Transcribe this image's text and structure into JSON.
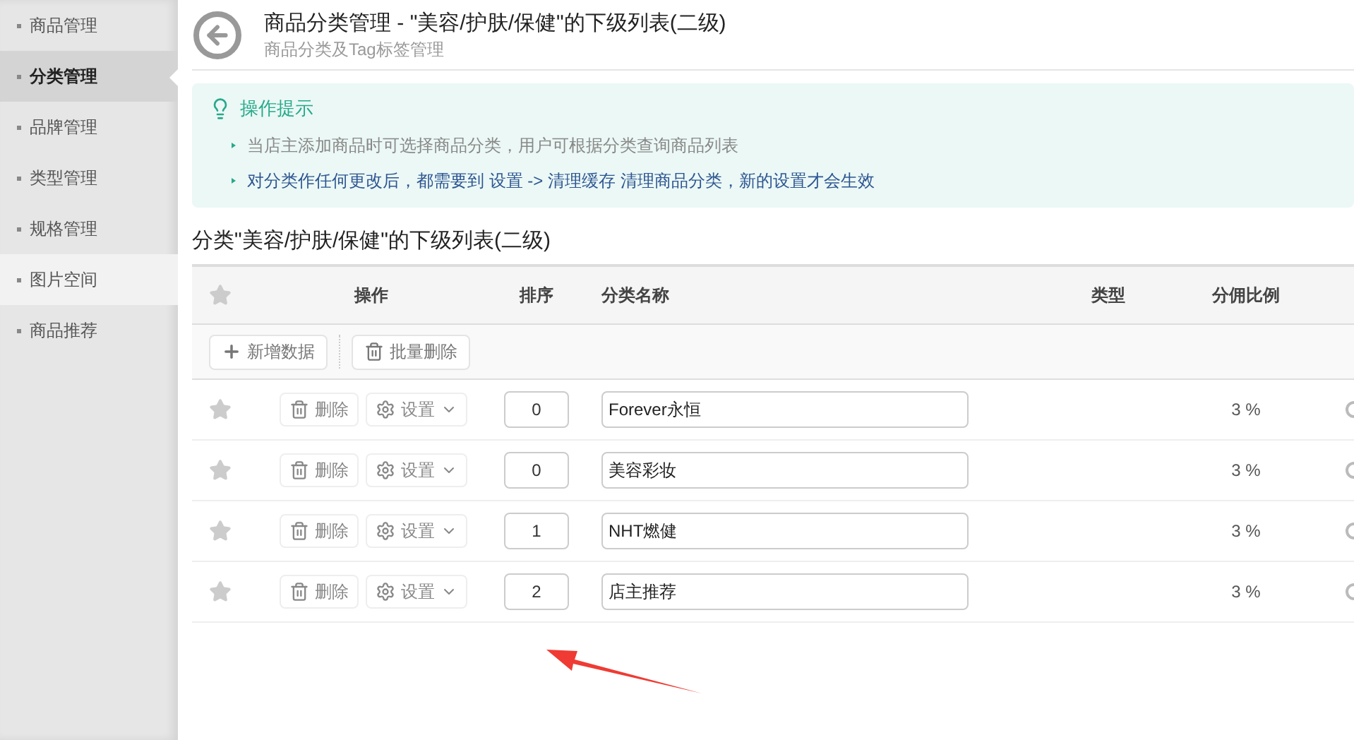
{
  "sidebar": {
    "items": [
      {
        "label": "商品管理",
        "selected": false,
        "hovered": false
      },
      {
        "label": "分类管理",
        "selected": true,
        "hovered": false
      },
      {
        "label": "品牌管理",
        "selected": false,
        "hovered": false
      },
      {
        "label": "类型管理",
        "selected": false,
        "hovered": false
      },
      {
        "label": "规格管理",
        "selected": false,
        "hovered": false
      },
      {
        "label": "图片空间",
        "selected": false,
        "hovered": true
      },
      {
        "label": "商品推荐",
        "selected": false,
        "hovered": false
      }
    ]
  },
  "header": {
    "title": "商品分类管理 - \"美容/护肤/保健\"的下级列表(二级)",
    "subtitle": "商品分类及Tag标签管理"
  },
  "tips": {
    "title": "操作提示",
    "items": [
      "当店主添加商品时可选择商品分类，用户可根据分类查询商品列表",
      "对分类作任何更改后，都需要到 设置 -> 清理缓存 清理商品分类，新的设置才会生效"
    ]
  },
  "section_title": "分类\"美容/护肤/保健\"的下级列表(二级)",
  "table": {
    "columns": [
      "操作",
      "排序",
      "分类名称",
      "类型",
      "分佣比例"
    ],
    "toolbar": [
      "新增数据",
      "批量删除"
    ],
    "rows": [
      {
        "delete": "删除",
        "settings": "设置",
        "sort": "0",
        "name": "Forever永恒",
        "ratio": "3 %"
      },
      {
        "delete": "删除",
        "settings": "设置",
        "sort": "0",
        "name": "美容彩妆",
        "ratio": "3 %"
      },
      {
        "delete": "删除",
        "settings": "设置",
        "sort": "1",
        "name": "NHT燃健",
        "ratio": "3 %"
      },
      {
        "delete": "删除",
        "settings": "设置",
        "sort": "2",
        "name": "店主推荐",
        "ratio": "3 %"
      }
    ]
  }
}
